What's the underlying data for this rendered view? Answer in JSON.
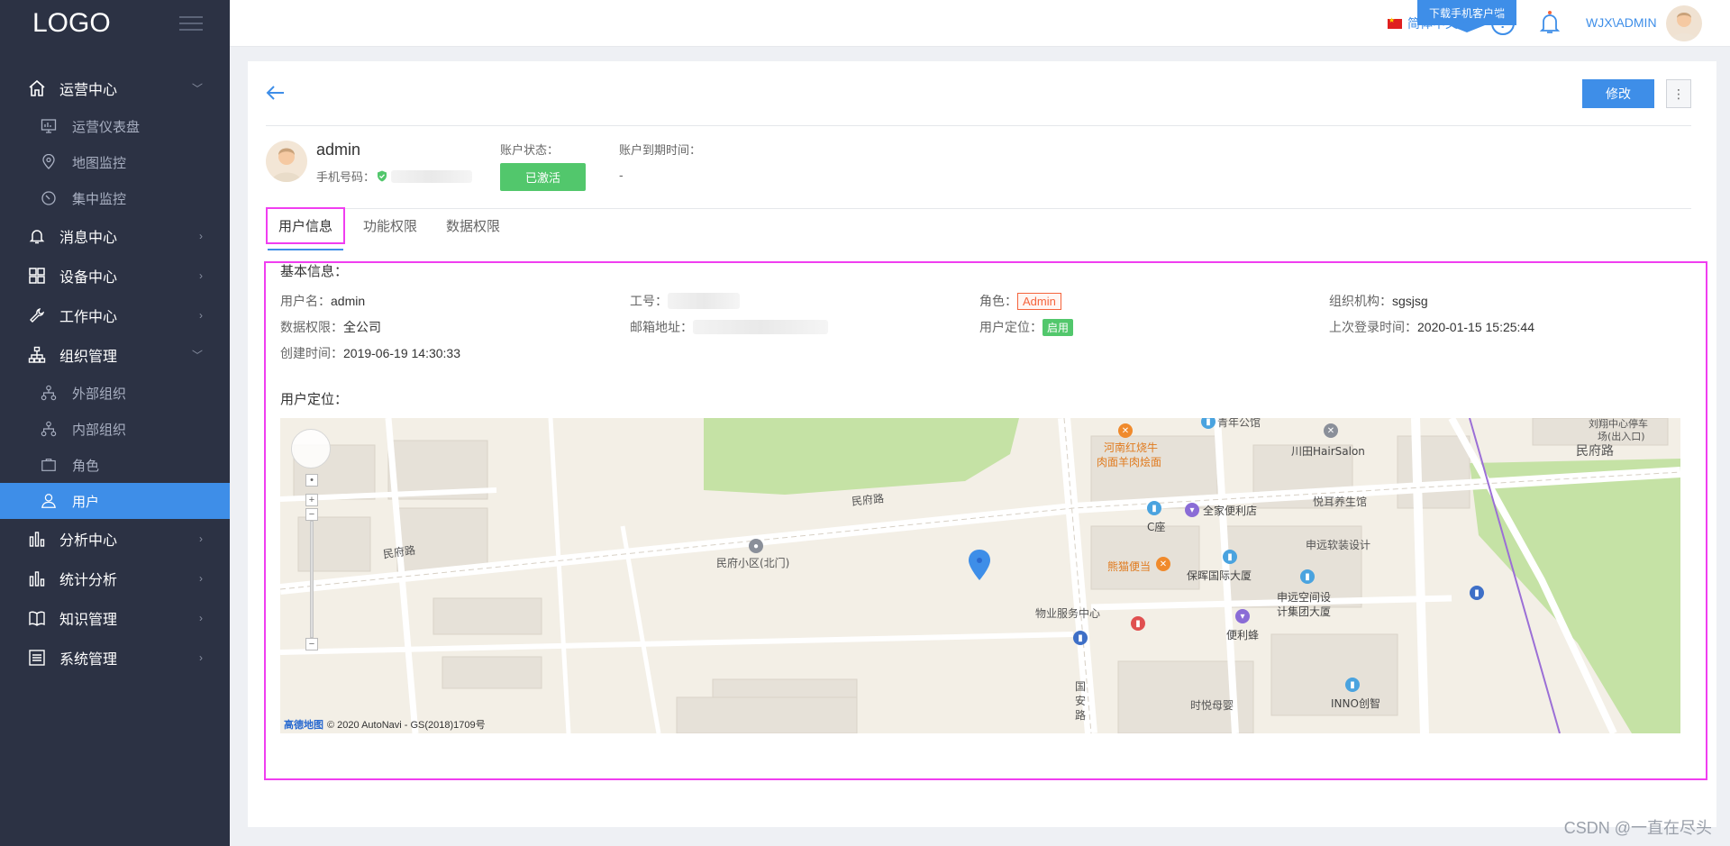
{
  "sidebar": {
    "logo": "LOGO",
    "menu": [
      {
        "label": "运营中心",
        "icon": "home-icon",
        "expanded": true,
        "children": [
          {
            "label": "运营仪表盘",
            "icon": "dashboard-icon"
          },
          {
            "label": "地图监控",
            "icon": "map-pin-icon"
          },
          {
            "label": "集中监控",
            "icon": "clock-icon"
          }
        ]
      },
      {
        "label": "消息中心",
        "icon": "bell-icon",
        "expanded": false
      },
      {
        "label": "设备中心",
        "icon": "grid-icon",
        "expanded": false
      },
      {
        "label": "工作中心",
        "icon": "wrench-icon",
        "expanded": false
      },
      {
        "label": "组织管理",
        "icon": "org-tree-icon",
        "expanded": true,
        "children": [
          {
            "label": "外部组织",
            "icon": "org-tree-icon"
          },
          {
            "label": "内部组织",
            "icon": "org-tree-icon"
          },
          {
            "label": "角色",
            "icon": "briefcase-icon"
          },
          {
            "label": "用户",
            "icon": "user-icon",
            "active": true
          }
        ]
      },
      {
        "label": "分析中心",
        "icon": "bar-chart-icon",
        "expanded": false
      },
      {
        "label": "统计分析",
        "icon": "bar-chart-icon",
        "expanded": false
      },
      {
        "label": "知识管理",
        "icon": "book-icon",
        "expanded": false
      },
      {
        "label": "系统管理",
        "icon": "settings-list-icon",
        "expanded": false
      }
    ]
  },
  "header": {
    "download_label": "下载手机客户端",
    "language": "简体中文",
    "help": "?",
    "username": "WJX\\ADMIN"
  },
  "toolbar": {
    "edit_label": "修改",
    "more_label": "⋮"
  },
  "profile": {
    "name": "admin",
    "phone_label": "手机号码：",
    "status_label": "账户状态：",
    "status_value": "已激活",
    "expire_label": "账户到期时间：",
    "expire_value": "-"
  },
  "tabs": [
    "用户信息",
    "功能权限",
    "数据权限"
  ],
  "basic_info": {
    "title": "基本信息：",
    "username_label": "用户名：",
    "username_value": "admin",
    "employee_no_label": "工号：",
    "role_label": "角色：",
    "role_value": "Admin",
    "org_label": "组织机构：",
    "org_value": "sgsjsg",
    "data_perm_label": "数据权限：",
    "data_perm_value": "全公司",
    "email_label": "邮箱地址：",
    "location_label": "用户定位：",
    "location_value": "启用",
    "last_login_label": "上次登录时间：",
    "last_login_value": "2020-01-15 15:25:44",
    "created_label": "创建时间：",
    "created_value": "2019-06-19 14:30:33"
  },
  "location_section": {
    "title": "用户定位："
  },
  "map": {
    "labels": {
      "road1": "民府路",
      "road2": "民府路",
      "road3": "民府路",
      "road_guoan": "国安路",
      "poi_minfu": "民府小区(北门)",
      "poi_henan": "河南红烧牛",
      "poi_henan2": "肉面羊肉烩面",
      "poi_qingnian": "青年公馆",
      "poi_chuantian": "川田HairSalon",
      "poi_liuxiang": "刘翔中心停车",
      "poi_liuxiang2": "场(出入口)",
      "poi_quanjia": "全家便利店",
      "poi_cseat": "C座",
      "poi_yueer": "悦耳养生馆",
      "poi_shenyuan_ruan": "申远软装设计",
      "poi_xiongmao": "熊猫便当",
      "poi_baohui": "保晖国际大厦",
      "poi_wuye": "物业服务中心",
      "poi_shenyuan_kong": "申远空间设",
      "poi_shenyuan_kong2": "计集团大厦",
      "poi_bianlifeng": "便利蜂",
      "poi_shiyue": "时悦母婴",
      "poi_inno": "INNO创智"
    },
    "provider": "高德地图",
    "copyright": "© 2020 AutoNavi - GS(2018)1709号"
  },
  "watermark": "CSDN @一直在尽头",
  "colors": {
    "primary": "#3e8ee8",
    "sidebar_bg": "#2c3244",
    "success": "#52c76c",
    "highlight": "#f03ef0",
    "role_tag": "#f5643c"
  }
}
